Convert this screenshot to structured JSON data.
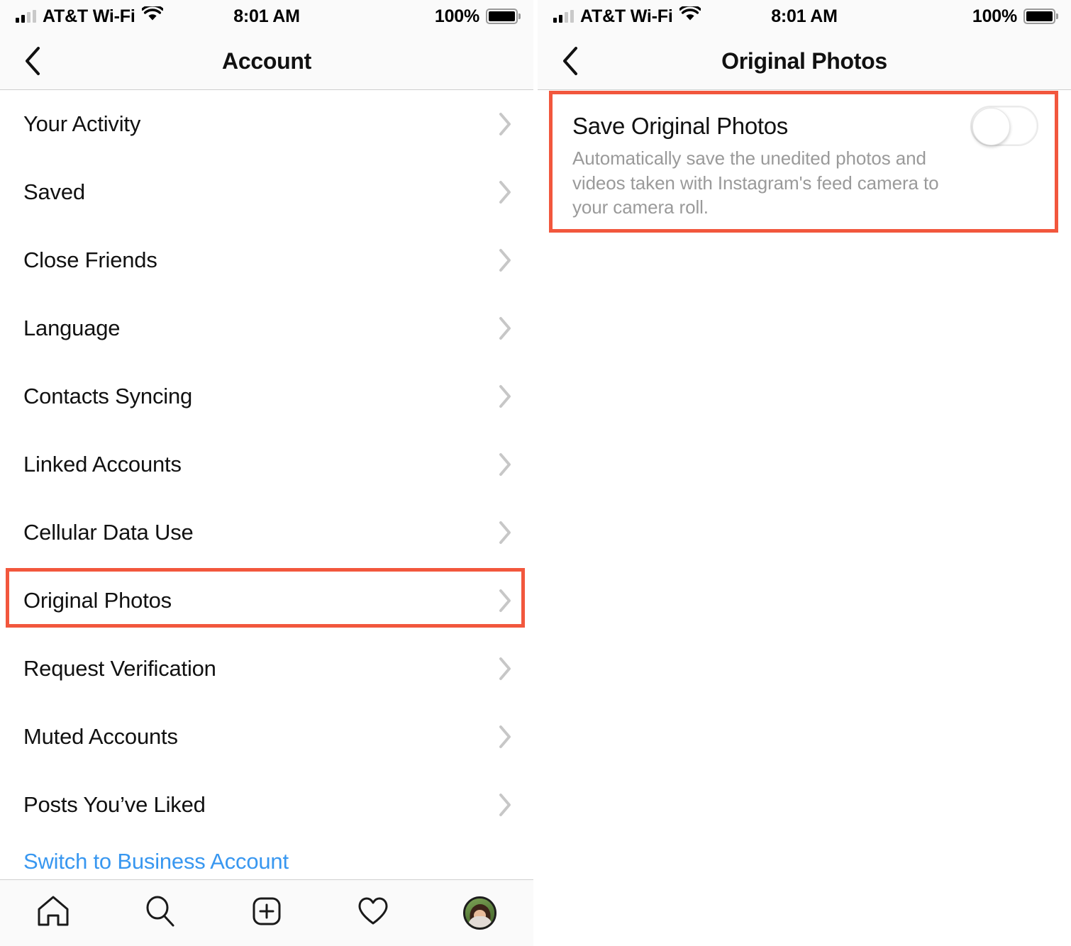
{
  "status_bar": {
    "carrier": "AT&T Wi-Fi",
    "time": "8:01 AM",
    "battery_percent": "100%",
    "wifi_icon": "wifi-icon",
    "signal_icon": "cellular-signal-icon",
    "battery_icon": "battery-full-icon"
  },
  "colors": {
    "highlight": "#f2573d",
    "link": "#3897f0",
    "chevron": "#c7c7c7",
    "muted_text": "#9a9a9a",
    "header_bg": "#fafafa"
  },
  "left_panel": {
    "nav": {
      "back_icon": "chevron-left-icon",
      "title": "Account"
    },
    "items": [
      {
        "label": "Your Activity",
        "chevron": "chevron-right-icon",
        "highlighted": false
      },
      {
        "label": "Saved",
        "chevron": "chevron-right-icon",
        "highlighted": false
      },
      {
        "label": "Close Friends",
        "chevron": "chevron-right-icon",
        "highlighted": false
      },
      {
        "label": "Language",
        "chevron": "chevron-right-icon",
        "highlighted": false
      },
      {
        "label": "Contacts Syncing",
        "chevron": "chevron-right-icon",
        "highlighted": false
      },
      {
        "label": "Linked Accounts",
        "chevron": "chevron-right-icon",
        "highlighted": false
      },
      {
        "label": "Cellular Data Use",
        "chevron": "chevron-right-icon",
        "highlighted": false
      },
      {
        "label": "Original Photos",
        "chevron": "chevron-right-icon",
        "highlighted": true
      },
      {
        "label": "Request Verification",
        "chevron": "chevron-right-icon",
        "highlighted": false
      },
      {
        "label": "Muted Accounts",
        "chevron": "chevron-right-icon",
        "highlighted": false
      },
      {
        "label": "Posts You’ve Liked",
        "chevron": "chevron-right-icon",
        "highlighted": false
      }
    ],
    "switch_account_link": "Switch to Business Account",
    "tab_bar": [
      {
        "name": "home-icon",
        "label": "Home"
      },
      {
        "name": "search-icon",
        "label": "Search"
      },
      {
        "name": "add-post-icon",
        "label": "New Post"
      },
      {
        "name": "heart-icon",
        "label": "Activity"
      },
      {
        "name": "profile-avatar",
        "label": "Profile"
      }
    ]
  },
  "right_panel": {
    "nav": {
      "back_icon": "chevron-left-icon",
      "title": "Original Photos"
    },
    "setting": {
      "title": "Save Original Photos",
      "description": "Automatically save the unedited photos and videos taken with Instagram's feed camera to your camera roll.",
      "toggle_state": "off",
      "highlighted": true
    }
  }
}
